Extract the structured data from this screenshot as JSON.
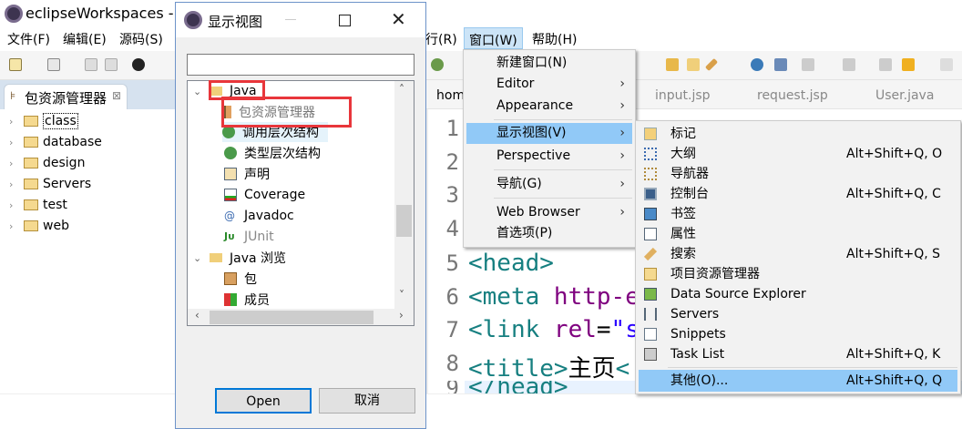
{
  "window": {
    "title": "eclipseWorkspaces - d"
  },
  "menubar": [
    "文件(F)",
    "编辑(E)",
    "源码(S)",
    "行(R)",
    "窗口(W)",
    "帮助(H)"
  ],
  "explorer": {
    "tab_label": "包资源管理器",
    "projects": [
      "class",
      "database",
      "design",
      "Servers",
      "test",
      "web"
    ]
  },
  "editor": {
    "tabs": [
      "hom",
      "input.jsp",
      "request.jsp",
      "User.java"
    ],
    "line_numbers": [
      "1",
      "2",
      "3",
      "4",
      "5",
      "6",
      "7",
      "8",
      "9"
    ],
    "lines": {
      "l5": "<head>",
      "l6a": "<meta ",
      "l6b": "http-e",
      "l7a": "<link ",
      "l7b": "rel",
      "l7c": "=",
      "l7d": "\"s",
      "l8a": "<title>",
      "l8b": "主页",
      "l8c": "<",
      "l9": "</head>"
    }
  },
  "dialog": {
    "title": "显示视图",
    "filter_value": "",
    "tree": [
      {
        "label": "Java",
        "children": [
          "包资源管理器",
          "调用层次结构",
          "类型层次结构",
          "声明",
          "Coverage",
          "Javadoc",
          "JUnit"
        ]
      },
      {
        "label": "Java 浏览",
        "children": [
          "包",
          "成员"
        ]
      }
    ],
    "open_label": "Open",
    "cancel_label": "取消"
  },
  "window_menu": {
    "items": [
      "新建窗口(N)",
      "Editor",
      "Appearance",
      "显示视图(V)",
      "Perspective",
      "导航(G)",
      "Web Browser",
      "首选项(P)"
    ]
  },
  "show_view_menu": {
    "items": [
      {
        "label": "标记",
        "shortcut": ""
      },
      {
        "label": "大纲",
        "shortcut": "Alt+Shift+Q, O"
      },
      {
        "label": "导航器",
        "shortcut": ""
      },
      {
        "label": "控制台",
        "shortcut": "Alt+Shift+Q, C"
      },
      {
        "label": "书签",
        "shortcut": ""
      },
      {
        "label": "属性",
        "shortcut": ""
      },
      {
        "label": "搜索",
        "shortcut": "Alt+Shift+Q, S"
      },
      {
        "label": "项目资源管理器",
        "shortcut": ""
      },
      {
        "label": "Data Source Explorer",
        "shortcut": ""
      },
      {
        "label": "Servers",
        "shortcut": ""
      },
      {
        "label": "Snippets",
        "shortcut": ""
      },
      {
        "label": "Task List",
        "shortcut": "Alt+Shift+Q, K"
      },
      {
        "label": "其他(O)...",
        "shortcut": "Alt+Shift+Q, Q"
      }
    ]
  },
  "colors": {
    "highlight": "#91c9f7",
    "annotation": "#e8363b"
  }
}
